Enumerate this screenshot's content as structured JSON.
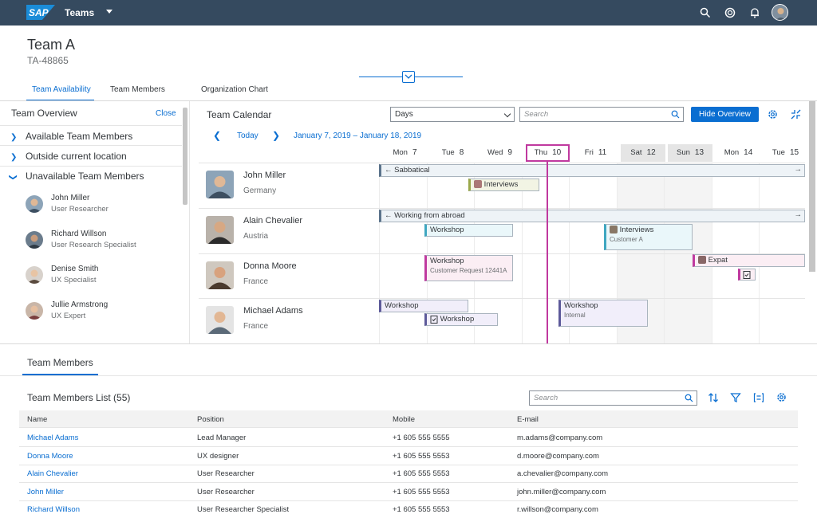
{
  "shell": {
    "brand": "SAP",
    "title": "Teams"
  },
  "header": {
    "title": "Team A",
    "subtitle": "TA-48865"
  },
  "tabs": [
    "Team Availability",
    "Team Members",
    "Organization Chart"
  ],
  "overview": {
    "title": "Team Overview",
    "close": "Close",
    "groups": [
      "Available Team Members",
      "Outside current location",
      "Unavailable Team Members"
    ],
    "members": [
      {
        "name": "John Miller",
        "role": "User Researcher"
      },
      {
        "name": "Richard Willson",
        "role": "User Research Specialist"
      },
      {
        "name": "Denise Smith",
        "role": "UX Specialist"
      },
      {
        "name": "Jullie Armstrong",
        "role": "UX Expert"
      }
    ]
  },
  "calendar": {
    "title": "Team Calendar",
    "view": "Days",
    "search_placeholder": "Search",
    "hide_button": "Hide Overview",
    "today": "Today",
    "range": "January 7, 2019 – January 18, 2019",
    "days": [
      {
        "d": "Mon",
        "n": "7"
      },
      {
        "d": "Tue",
        "n": "8"
      },
      {
        "d": "Wed",
        "n": "9"
      },
      {
        "d": "Thu",
        "n": "10"
      },
      {
        "d": "Fri",
        "n": "11"
      },
      {
        "d": "Sat",
        "n": "12"
      },
      {
        "d": "Sun",
        "n": "13"
      },
      {
        "d": "Mon",
        "n": "14"
      },
      {
        "d": "Tue",
        "n": "15"
      }
    ],
    "people": [
      {
        "name": "John Miller",
        "location": "Germany"
      },
      {
        "name": "Alain Chevalier",
        "location": "Austria"
      },
      {
        "name": "Donna Moore",
        "location": "France"
      },
      {
        "name": "Michael Adams",
        "location": "France"
      }
    ],
    "appointments": {
      "sabbatical": "Sabbatical",
      "interviews1": "Interviews",
      "abroad": "Working from abroad",
      "workshop1": "Workshop",
      "interviews2": "Interviews",
      "interviews2_sub": "Customer A",
      "workshop2": "Workshop",
      "workshop2_sub": "Customer Request 12441A",
      "expat": "Expat",
      "workshop3": "Workshop",
      "workshop4": "Workshop",
      "workshop5": "Workshop",
      "workshop5_sub": "Internal"
    }
  },
  "members_section": {
    "title": "Team Members",
    "list_title": "Team Members List (55)",
    "search_placeholder": "Search",
    "columns": [
      "Name",
      "Position",
      "Mobile",
      "E-mail"
    ],
    "rows": [
      [
        "Michael Adams",
        "Lead Manager",
        "+1 605 555 5555",
        "m.adams@company.com"
      ],
      [
        "Donna Moore",
        "UX designer",
        "+1 605 555 5553",
        "d.moore@company.com"
      ],
      [
        "Alain Chevalier",
        "User Researcher",
        "+1 605 555 5553",
        "a.chevalier@company.com"
      ],
      [
        "John Miller",
        "User Researcher",
        "+1 605 555 5553",
        "john.miller@company.com"
      ],
      [
        "Richard Willson",
        "User Researcher Specialist",
        "+1 605 555 5553",
        "r.willson@company.com"
      ]
    ]
  }
}
